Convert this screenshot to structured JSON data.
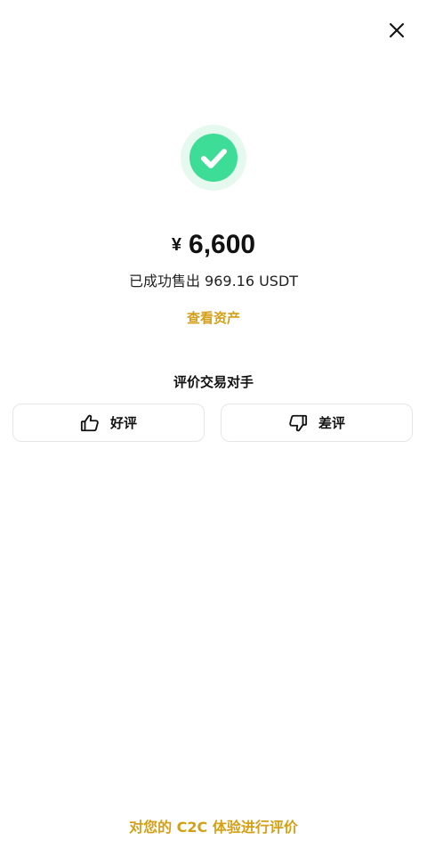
{
  "header": {
    "close_icon": "close-icon"
  },
  "status": {
    "icon": "check-circle-icon",
    "accent_color": "#3ddc97",
    "halo_color": "#e6f9ef"
  },
  "summary": {
    "currency_symbol": "¥",
    "amount": "6,600",
    "sold_text": "已成功售出 969.16 USDT",
    "view_assets_label": "查看资产"
  },
  "rating": {
    "title": "评价交易对手",
    "good_label": "好评",
    "bad_label": "差评",
    "good_icon": "thumbs-up-icon",
    "bad_icon": "thumbs-down-icon"
  },
  "footer": {
    "rate_experience_label": "对您的 C2C 体验进行评价",
    "link_color": "#d4a017"
  }
}
